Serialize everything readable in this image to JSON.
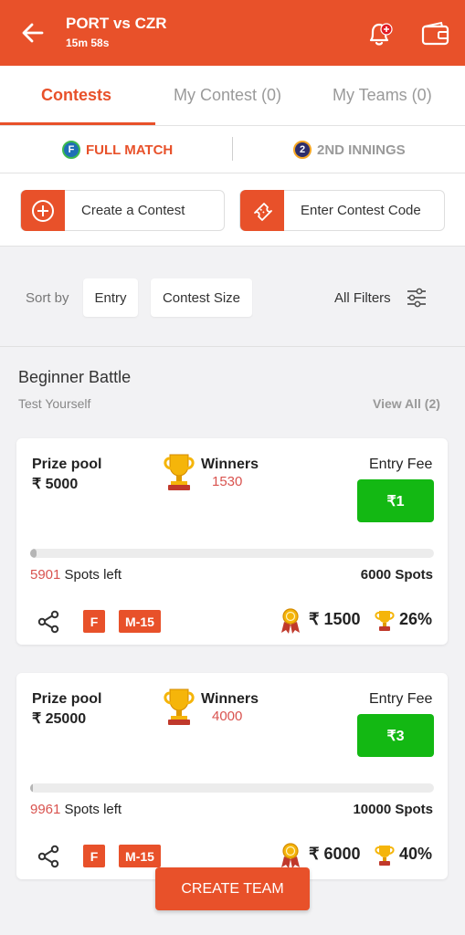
{
  "header": {
    "title": "PORT vs CZR",
    "timer": "15m 58s"
  },
  "tabs": [
    {
      "label": "Contests",
      "active": true
    },
    {
      "label": "My Contest (0)",
      "active": false
    },
    {
      "label": "My Teams (0)",
      "active": false
    }
  ],
  "innings": [
    {
      "badge": "F",
      "label": "FULL MATCH",
      "active": true
    },
    {
      "badge": "2",
      "label": "2ND INNINGS",
      "active": false
    }
  ],
  "actions": {
    "create": "Create a Contest",
    "code": "Enter Contest Code"
  },
  "sort": {
    "label": "Sort by",
    "chips": [
      "Entry",
      "Contest Size"
    ],
    "filters": "All Filters"
  },
  "section": {
    "title": "Beginner Battle",
    "subtitle": "Test Yourself",
    "view_all": "View All (2)"
  },
  "contests": [
    {
      "prize_label": "Prize pool",
      "prize": "₹ 5000",
      "winners_label": "Winners",
      "winners": "1530",
      "entry_label": "Entry Fee",
      "entry_fee": "₹1",
      "spots_left_n": "5901",
      "spots_left_txt": " Spots left",
      "spots_total": "6000 Spots",
      "fill_fraction": 0.016,
      "tags": [
        "F",
        "M-15"
      ],
      "first_prize": "₹ 1500",
      "win_pct": "26%"
    },
    {
      "prize_label": "Prize pool",
      "prize": "₹ 25000",
      "winners_label": "Winners",
      "winners": "4000",
      "entry_label": "Entry Fee",
      "entry_fee": "₹3",
      "spots_left_n": "9961",
      "spots_left_txt": " Spots left",
      "spots_total": "10000 Spots",
      "fill_fraction": 0.004,
      "tags": [
        "F",
        "M-15"
      ],
      "first_prize": "₹ 6000",
      "win_pct": "40%"
    }
  ],
  "cta": {
    "label": "CREATE TEAM"
  },
  "colors": {
    "accent": "#e8512a",
    "entry_green": "#13b813",
    "spots_red": "#d9534f"
  },
  "icons": [
    "back-arrow-icon",
    "bell-icon",
    "wallet-icon",
    "plus-circle-icon",
    "ticket-icon",
    "filter-sliders-icon",
    "trophy-icon",
    "share-icon",
    "medal-icon"
  ]
}
